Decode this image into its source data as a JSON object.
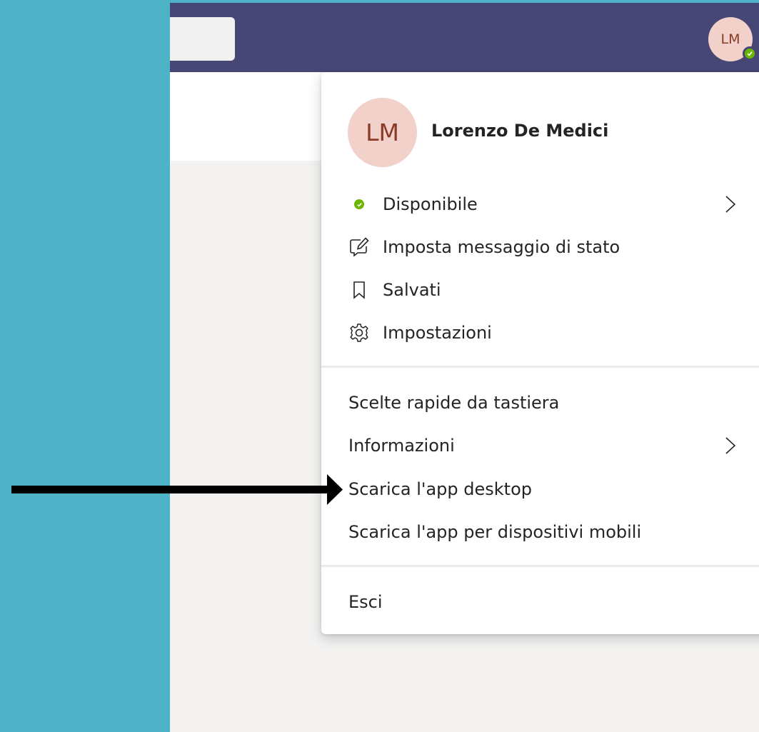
{
  "topbar": {
    "avatar_initials": "LM"
  },
  "profile": {
    "initials": "LM",
    "name": "Lorenzo De Medici"
  },
  "menu": {
    "status": {
      "label": "Disponibile",
      "icon": "status-available-icon",
      "color": "#6bb700"
    },
    "set_status_message": {
      "label": "Imposta messaggio di stato",
      "icon": "edit-message-icon"
    },
    "saved": {
      "label": "Salvati",
      "icon": "bookmark-icon"
    },
    "settings": {
      "label": "Impostazioni",
      "icon": "gear-icon"
    },
    "keyboard_shortcuts": {
      "label": "Scelte rapide da tastiera"
    },
    "about": {
      "label": "Informazioni"
    },
    "download_desktop": {
      "label": "Scarica l'app desktop"
    },
    "download_mobile": {
      "label": "Scarica l'app per dispositivi mobili"
    },
    "sign_out": {
      "label": "Esci"
    }
  },
  "colors": {
    "accent_bar": "#464775",
    "background": "#4fb3c8",
    "presence": "#6bb700"
  }
}
